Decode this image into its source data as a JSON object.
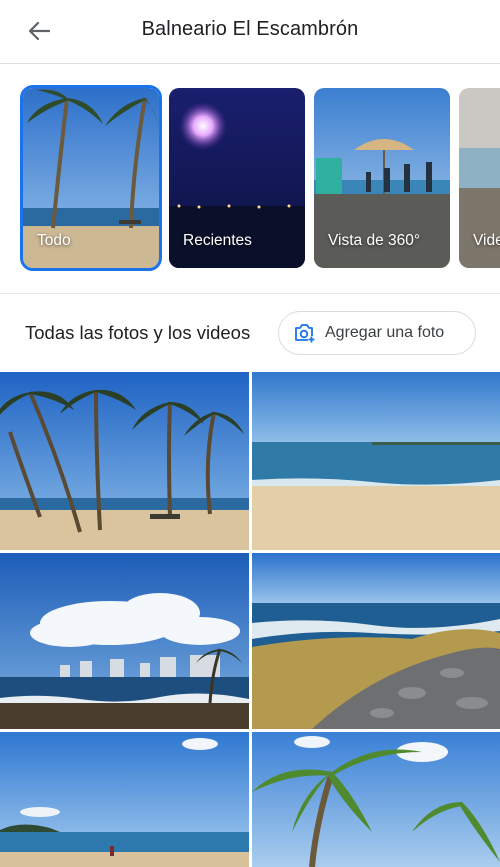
{
  "header": {
    "title": "Balneario El Escambrón",
    "back_icon": "arrow-back-icon"
  },
  "categories": [
    {
      "label": "Todo",
      "selected": true
    },
    {
      "label": "Recientes",
      "selected": false
    },
    {
      "label": "Vista de 360°",
      "selected": false
    },
    {
      "label": "Videos",
      "selected": false
    }
  ],
  "section": {
    "title": "Todas las fotos y los videos",
    "add_photo_label": "Agregar una foto",
    "add_icon": "add-photo-icon"
  },
  "photos": [
    {
      "id": "palms-beach"
    },
    {
      "id": "sandy-shore"
    },
    {
      "id": "city-skyline"
    },
    {
      "id": "rocky-coast"
    },
    {
      "id": "beach-island"
    },
    {
      "id": "palm-fronds"
    }
  ],
  "colors": {
    "accent": "#1a73e8",
    "sky": "#2f7fd6",
    "sea": "#1f6fa8",
    "sand": "#e3cfa7"
  }
}
